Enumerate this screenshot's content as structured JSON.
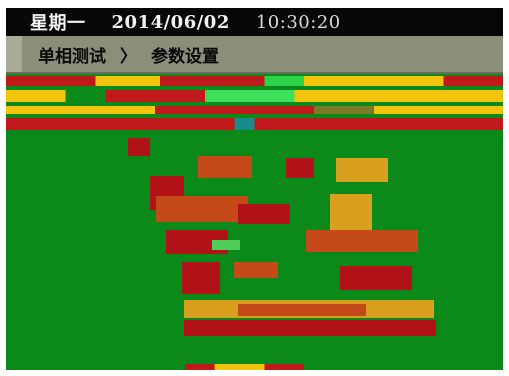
{
  "status_bar": {
    "weekday": "星期一",
    "date": "2014/06/02",
    "time": "10:30:20"
  },
  "breadcrumb": {
    "section": "单相测试",
    "separator": "〉",
    "page": "参数设置"
  },
  "colors": {
    "screen_background": "#0b8a1a",
    "status_bar_background": "#080808",
    "breadcrumb_background": "#8a8f7a"
  }
}
